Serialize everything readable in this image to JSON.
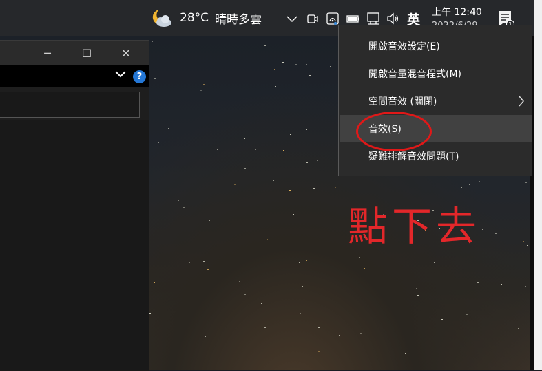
{
  "taskbar": {
    "weather": {
      "icon": "partly-cloudy-night-icon",
      "temperature": "28°C",
      "condition": "晴時多雲"
    },
    "tray_icons": [
      "chevron-up-icon",
      "meet-now-icon",
      "network-icon",
      "battery-icon",
      "ethernet-icon",
      "volume-icon"
    ],
    "ime_indicator": "英",
    "clock": {
      "time": "上午 12:40",
      "date": "2022/6/29"
    },
    "notification_icon": "notification-center-icon",
    "notification_count": "1"
  },
  "window": {
    "controls": {
      "minimize": "─",
      "maximize": "☐",
      "close": "✕"
    },
    "help_label": "?"
  },
  "context_menu": {
    "items": [
      {
        "label": "開啟音效設定(E)"
      },
      {
        "label": "開啟音量混音程式(M)"
      },
      {
        "label": "空間音效 (關閉)",
        "has_submenu": true
      },
      {
        "label": "音效(S)",
        "highlighted": true
      },
      {
        "label": "疑難排解音效問題(T)"
      }
    ]
  },
  "annotation": {
    "text": "點下去",
    "color": "#e3272a"
  },
  "colors": {
    "taskbar": "#26282b",
    "menu_bg": "#2b2b2b",
    "menu_hover": "#414141",
    "highlight_circle": "#e01818"
  }
}
